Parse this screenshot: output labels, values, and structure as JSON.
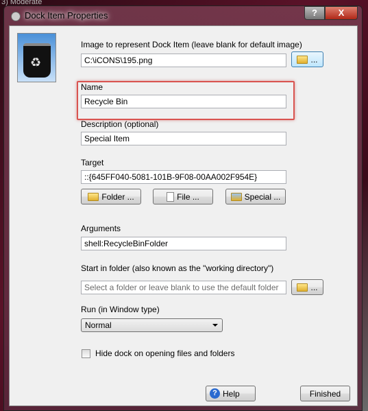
{
  "background": {
    "text": "3) Moderate"
  },
  "window": {
    "title": "Dock Item Properties",
    "help_glyph": "?",
    "close_glyph": "X"
  },
  "image": {
    "label": "Image to represent Dock Item (leave blank for default image)",
    "value": "C:\\iCONS\\195.png",
    "browse_label": "...",
    "icon": "recycle-bin-icon"
  },
  "name": {
    "label": "Name",
    "value": "Recycle Bin",
    "highlight_color": "#d9534f"
  },
  "description": {
    "label": "Description (optional)",
    "value": "Special Item"
  },
  "target": {
    "label": "Target",
    "value": "::{645FF040-5081-101B-9F08-00AA002F954E}",
    "folder_label": "Folder ...",
    "file_label": "File ...",
    "special_label": "Special ..."
  },
  "arguments": {
    "label": "Arguments",
    "value": "shell:RecycleBinFolder"
  },
  "start_in": {
    "label": "Start in folder (also known as the \"working directory\")",
    "value": "",
    "placeholder": "Select a folder or leave blank to use the default folder",
    "browse_label": "..."
  },
  "run": {
    "label": "Run (in  Window type)",
    "selected": "Normal"
  },
  "hide_dock": {
    "label": "Hide dock on opening files and folders",
    "checked": false
  },
  "footer": {
    "help_label": "Help",
    "finished_label": "Finished"
  }
}
